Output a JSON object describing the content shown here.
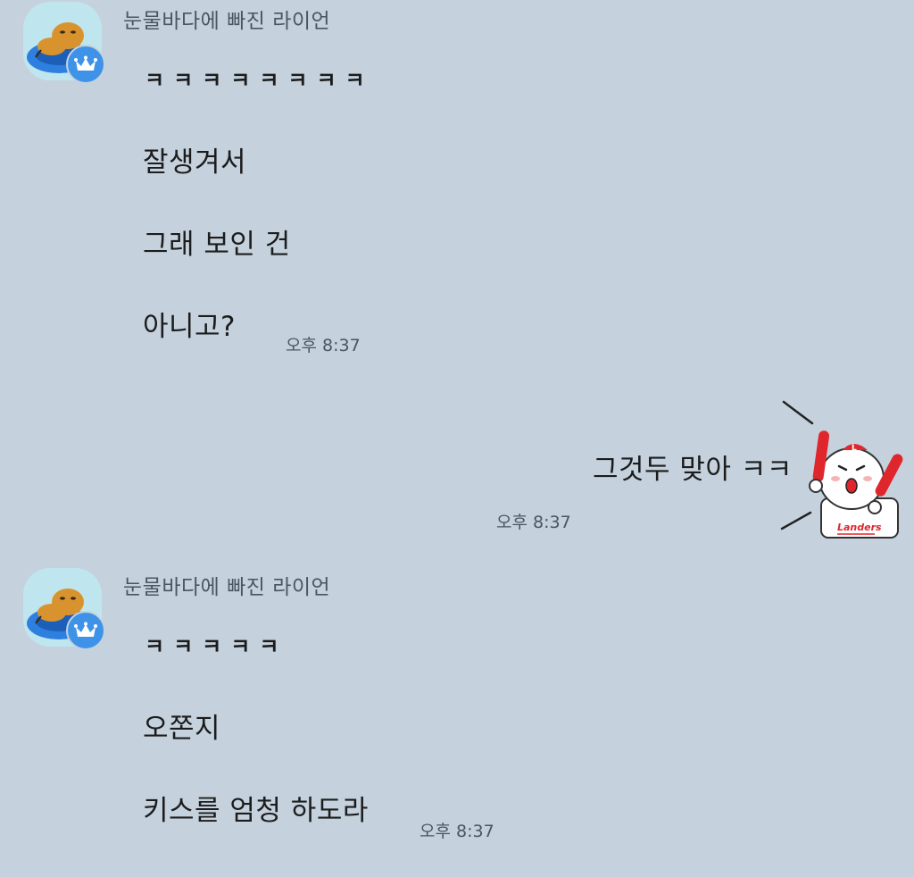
{
  "groups": [
    {
      "sender": "눈물바다에 빠진 라이언",
      "avatar_icon": "ryan-floating-tube-avatar",
      "badge_icon": "crown-icon",
      "messages": [
        "ㅋㅋㅋㅋㅋㅋㅋㅋ",
        "잘생겨서",
        "그래 보인 건",
        "아니고?"
      ],
      "time": "오후 8:37"
    },
    {
      "mine": true,
      "message": "그것두 맞아 ㅋㅋ",
      "sticker": "landers-baseball-cheer-sticker",
      "sticker_text": "Landers",
      "time": "오후 8:37"
    },
    {
      "sender": "눈물바다에 빠진 라이언",
      "avatar_icon": "ryan-floating-tube-avatar",
      "badge_icon": "crown-icon",
      "messages": [
        "ㅋㅋㅋㅋㅋ",
        "오쫀지",
        "키스를 엄청 하도라"
      ],
      "time": "오후 8:37"
    }
  ],
  "colors": {
    "background": "#c5d2de",
    "badge": "#3e93e8",
    "avatar_bg": "#bfe6ee",
    "sticker_accent": "#e0262d"
  }
}
